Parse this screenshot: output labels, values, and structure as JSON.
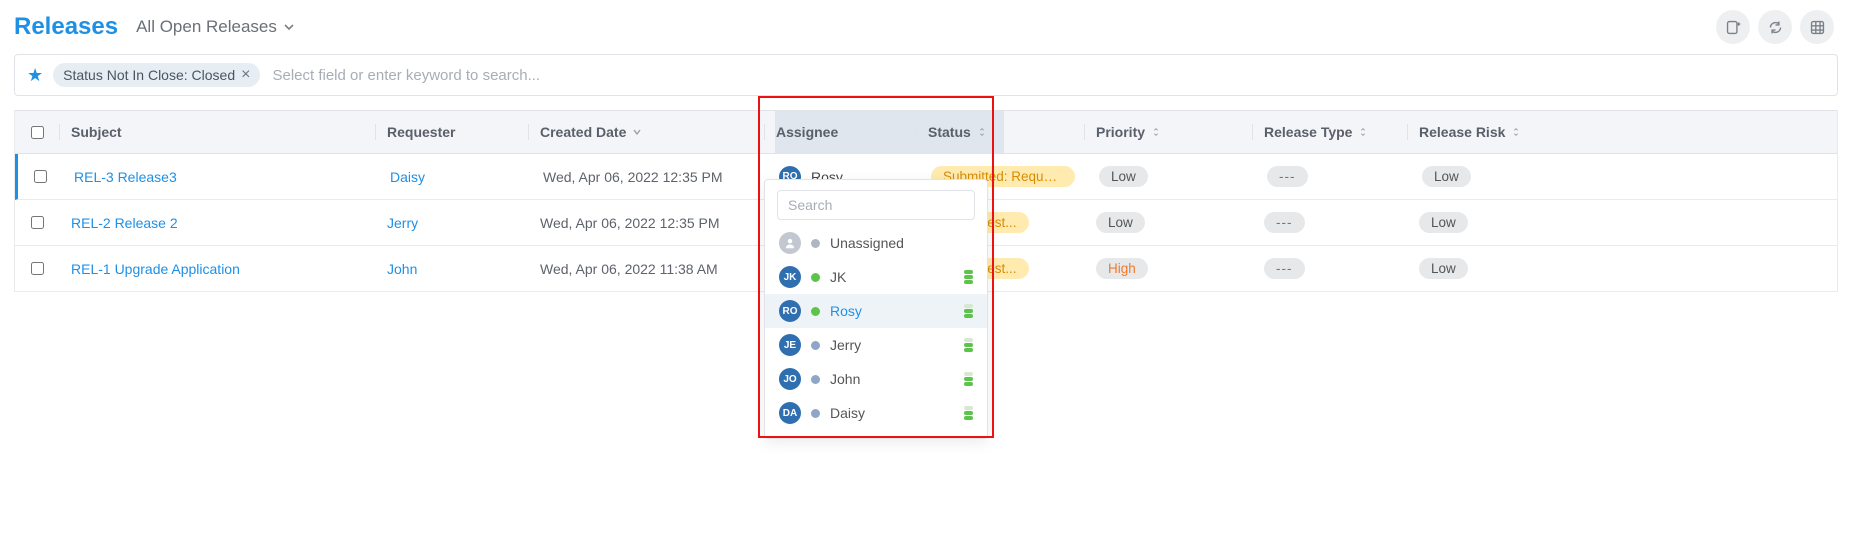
{
  "header": {
    "title": "Releases",
    "view": "All Open Releases"
  },
  "filter": {
    "chip": "Status Not In Close: Closed",
    "placeholder": "Select field or enter keyword to search..."
  },
  "columns": {
    "subject": "Subject",
    "requester": "Requester",
    "created": "Created Date",
    "assignee": "Assignee",
    "status": "Status",
    "priority": "Priority",
    "reltype": "Release Type",
    "relrisk": "Release Risk"
  },
  "rows": [
    {
      "subject": "REL-3 Release3",
      "requester": "Daisy",
      "created": "Wed, Apr 06, 2022 12:35 PM",
      "assignee_initials": "RO",
      "assignee_name": "Rosy",
      "status": "Submitted: Request...",
      "priority": "Low",
      "reltype": "---",
      "relrisk": "Low"
    },
    {
      "subject": "REL-2 Release 2",
      "requester": "Jerry",
      "created": "Wed, Apr 06, 2022 12:35 PM",
      "assignee_initials": "",
      "assignee_name": "",
      "status": "d: Request...",
      "priority": "Low",
      "reltype": "---",
      "relrisk": "Low"
    },
    {
      "subject": "REL-1 Upgrade Application",
      "requester": "John",
      "created": "Wed, Apr 06, 2022 11:38 AM",
      "assignee_initials": "",
      "assignee_name": "",
      "status": "d: Request...",
      "priority": "High",
      "reltype": "---",
      "relrisk": "Low"
    }
  ],
  "assignee_popover": {
    "search_placeholder": "Search",
    "options": [
      {
        "initials": "",
        "name": "Unassigned",
        "avatar": "gray",
        "presence": "gray",
        "workload": "none"
      },
      {
        "initials": "JK",
        "name": "JK",
        "avatar": "blue",
        "presence": "green",
        "workload": "full"
      },
      {
        "initials": "RO",
        "name": "Rosy",
        "avatar": "blue",
        "presence": "green",
        "workload": "partial",
        "selected": true
      },
      {
        "initials": "JE",
        "name": "Jerry",
        "avatar": "blue",
        "presence": "blue",
        "workload": "partial"
      },
      {
        "initials": "JO",
        "name": "John",
        "avatar": "blue",
        "presence": "blue",
        "workload": "partial"
      },
      {
        "initials": "DA",
        "name": "Daisy",
        "avatar": "blue",
        "presence": "blue",
        "workload": "partial"
      }
    ]
  }
}
